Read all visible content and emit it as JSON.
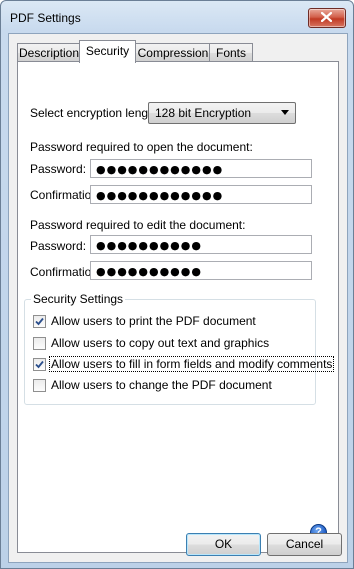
{
  "window": {
    "title": "PDF Settings"
  },
  "tabs": [
    {
      "label": "Description"
    },
    {
      "label": "Security",
      "active": true
    },
    {
      "label": "Compression"
    },
    {
      "label": "Fonts"
    }
  ],
  "encryption": {
    "label": "Select encryption length:",
    "selected": "128 bit Encryption"
  },
  "open_password": {
    "heading": "Password required to open the document:",
    "password_label": "Password:",
    "password_value": "●●●●●●●●●●●●",
    "confirm_label": "Confirmation:",
    "confirm_value": "●●●●●●●●●●●●"
  },
  "edit_password": {
    "heading": "Password required to edit the document:",
    "password_label": "Password:",
    "password_value": "●●●●●●●●●●",
    "confirm_label": "Confirmation:",
    "confirm_value": "●●●●●●●●●●"
  },
  "security_settings": {
    "title": "Security Settings",
    "options": [
      {
        "label": "Allow users to print the PDF document",
        "checked": true
      },
      {
        "label": "Allow users to copy out text and graphics",
        "checked": false
      },
      {
        "label": "Allow users to fill in form fields and modify comments",
        "checked": true,
        "focused": true
      },
      {
        "label": "Allow users to change the PDF document",
        "checked": false
      }
    ]
  },
  "help": {
    "glyph": "?"
  },
  "buttons": {
    "ok": "OK",
    "cancel": "Cancel"
  },
  "icons": {
    "close": "close-icon",
    "help": "help-icon",
    "dropdown": "chevron-down-icon",
    "check": "checkmark-icon"
  }
}
